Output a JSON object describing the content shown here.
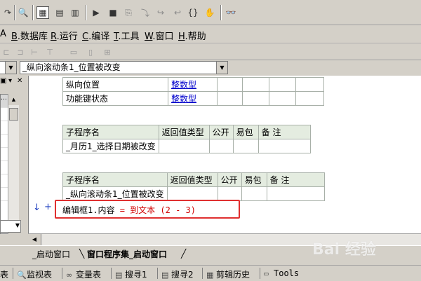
{
  "menu": {
    "items": [
      {
        "prefix": "",
        "key": "",
        "text": "A"
      },
      {
        "prefix": "",
        "key": "B",
        "text": ".数据库"
      },
      {
        "prefix": "",
        "key": "R",
        "text": ".运行"
      },
      {
        "prefix": "",
        "key": "C",
        "text": ".编译"
      },
      {
        "prefix": "",
        "key": "T",
        "text": ".工具"
      },
      {
        "prefix": "",
        "key": "W",
        "text": ".窗口"
      },
      {
        "prefix": "",
        "key": "H",
        "text": ".帮助"
      }
    ],
    "first_label": "h"
  },
  "selector": {
    "sub_selected": "_纵向滚动条1_位置被改变"
  },
  "params_table": {
    "rows": [
      {
        "name": "纵向位置",
        "type": "整数型"
      },
      {
        "name": "功能键状态",
        "type": "整数型"
      }
    ]
  },
  "sub_table1": {
    "headers": [
      "子程序名",
      "返回值类型",
      "公开",
      "易包",
      "备 注"
    ],
    "name": "_月历1_选择日期被改变"
  },
  "sub_table2": {
    "headers": [
      "子程序名",
      "返回值类型",
      "公开",
      "易包",
      "备 注"
    ],
    "name": "_纵向滚动条1_位置被改变"
  },
  "code": {
    "left": "编辑框1.内容",
    "op": "=",
    "func": "到文本",
    "args": "(2 - 3)"
  },
  "tabs": [
    {
      "label": "_启动窗口"
    },
    {
      "label": "窗口程序集_启动窗口"
    }
  ],
  "bottom": {
    "items": [
      "表",
      "监视表",
      "变量表",
      "搜寻1",
      "搜寻2",
      "剪辑历史",
      "Tools"
    ]
  },
  "watermark": "Bai 经验"
}
